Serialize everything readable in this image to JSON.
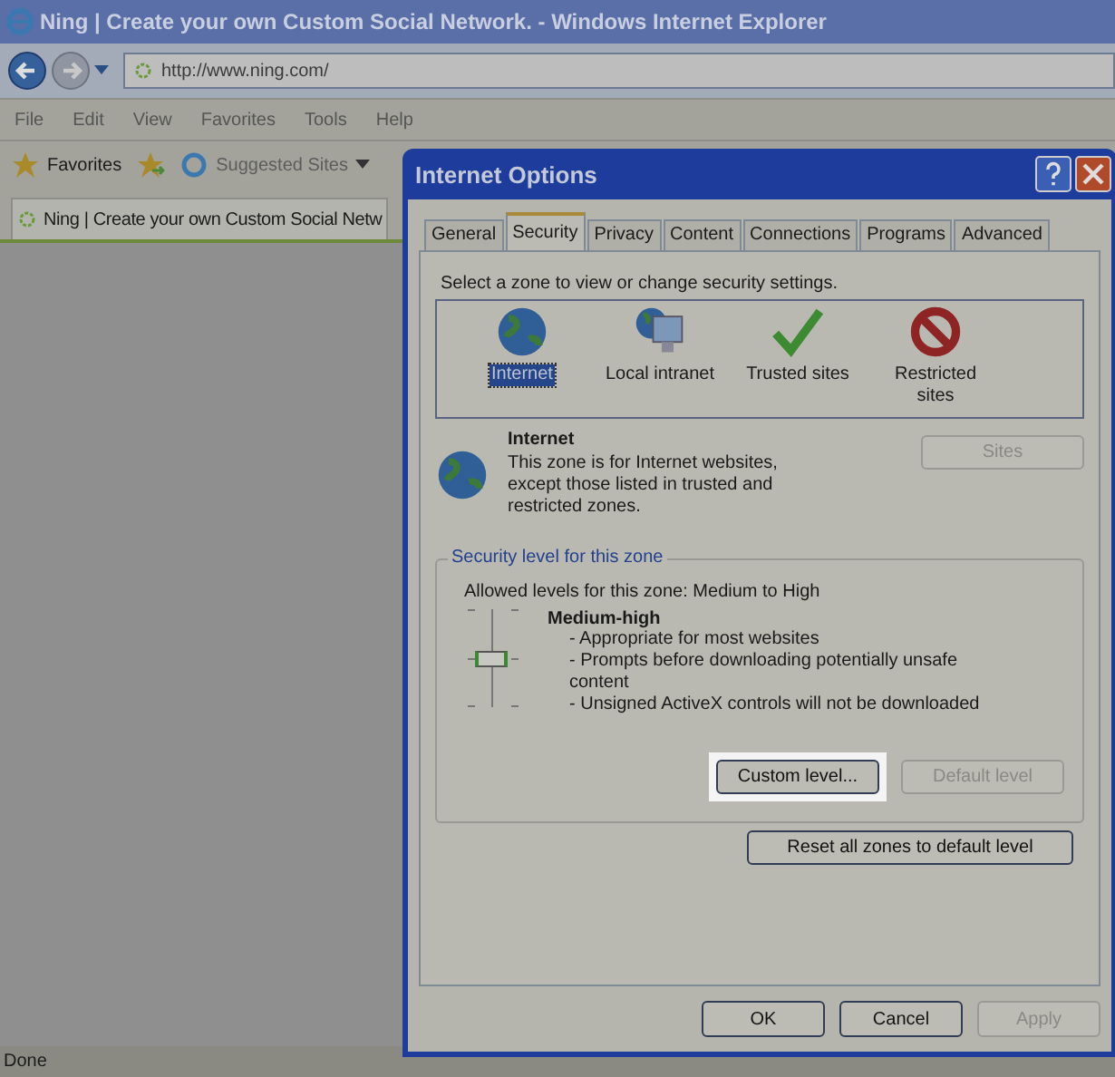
{
  "browser": {
    "title": "Ning | Create your own Custom Social Network. - Windows Internet Explorer",
    "address": "http://www.ning.com/",
    "menu": [
      "File",
      "Edit",
      "View",
      "Favorites",
      "Tools",
      "Help"
    ],
    "favorites": "Favorites",
    "suggested": "Suggested Sites",
    "tab": "Ning | Create your own Custom Social Netw",
    "status": "Done"
  },
  "dialog": {
    "title": "Internet Options",
    "tabs": [
      {
        "label": "General",
        "selected": false
      },
      {
        "label": "Security",
        "selected": true
      },
      {
        "label": "Privacy",
        "selected": false
      },
      {
        "label": "Content",
        "selected": false
      },
      {
        "label": "Connections",
        "selected": false
      },
      {
        "label": "Programs",
        "selected": false
      },
      {
        "label": "Advanced",
        "selected": false
      }
    ],
    "zone_prompt": "Select a zone to view or change security settings.",
    "zones": [
      {
        "label": "Internet",
        "kind": "globe",
        "selected": true
      },
      {
        "label": "Local intranet",
        "kind": "intranet",
        "selected": false
      },
      {
        "label": "Trusted sites",
        "kind": "check",
        "selected": false
      },
      {
        "label": "Restricted sites",
        "kind": "forbidden",
        "selected": false
      }
    ],
    "zone_name": "Internet",
    "zone_description": "This zone is for Internet websites, except those listed in trusted and restricted zones.",
    "sites_button": {
      "label": "Sites",
      "disabled": true
    },
    "group_legend": "Security level for this zone",
    "allowed": "Allowed levels for this zone: Medium to High",
    "level": 0.5,
    "level_name": "Medium-high",
    "bullets": [
      "- Appropriate for most websites",
      "- Prompts before downloading potentially unsafe content",
      "- Unsigned ActiveX controls will not be downloaded"
    ],
    "level_buttons": [
      {
        "label": "Custom level...",
        "disabled": false,
        "highlighted": true
      },
      {
        "label": "Default level",
        "disabled": true,
        "highlighted": false
      }
    ],
    "reset_button": {
      "label": "Reset all zones to default level",
      "disabled": false
    },
    "footer_buttons": [
      {
        "label": "OK",
        "disabled": false
      },
      {
        "label": "Cancel",
        "disabled": false
      },
      {
        "label": "Apply",
        "disabled": true
      }
    ]
  }
}
